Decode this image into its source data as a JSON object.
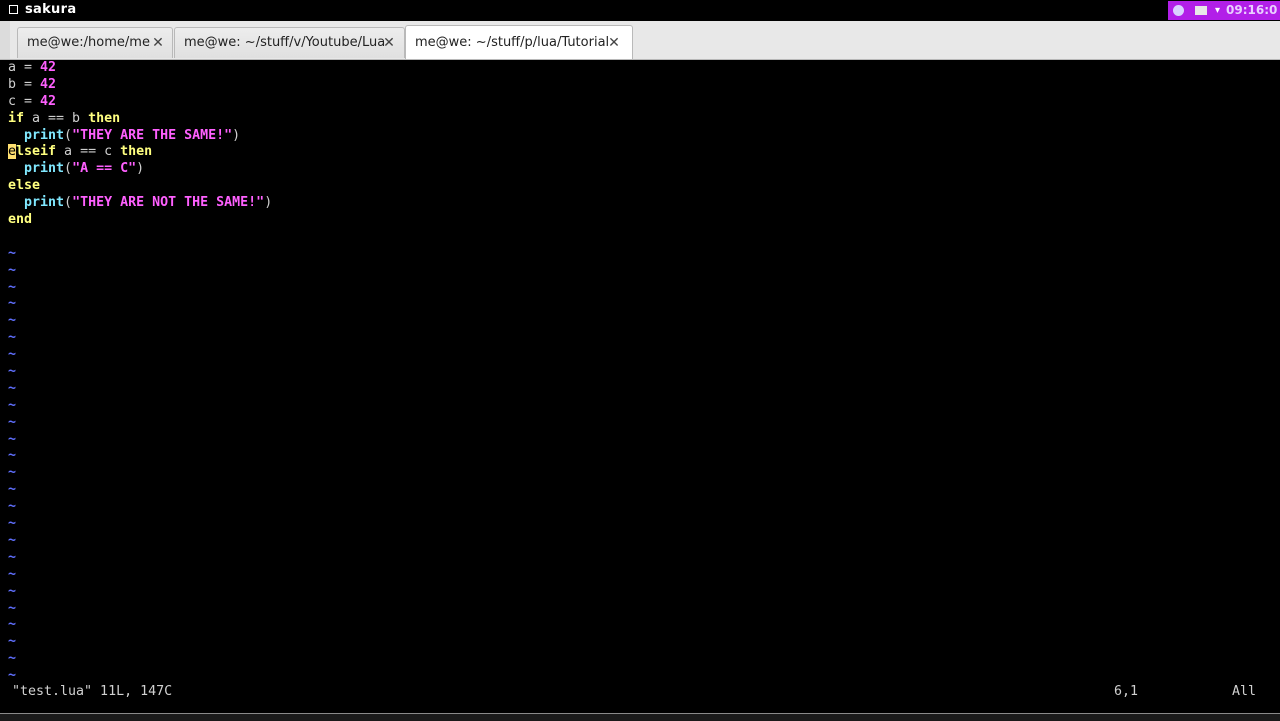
{
  "window": {
    "title": "sakura"
  },
  "tray": {
    "clock": "09:16:0"
  },
  "tabs": [
    {
      "label": "me@we:/home/me",
      "close": "✕"
    },
    {
      "label": "me@we: ~/stuff/v/Youtube/Lua",
      "close": "✕"
    },
    {
      "label": "me@we: ~/stuff/p/lua/Tutorial",
      "close": "✕"
    }
  ],
  "editor": {
    "lines": [
      [
        {
          "t": "a = ",
          "c": "plain"
        },
        {
          "t": "42",
          "c": "num"
        }
      ],
      [
        {
          "t": "b = ",
          "c": "plain"
        },
        {
          "t": "42",
          "c": "num"
        }
      ],
      [
        {
          "t": "c = ",
          "c": "plain"
        },
        {
          "t": "42",
          "c": "num"
        }
      ],
      [
        {
          "t": "if",
          "c": "kw"
        },
        {
          "t": " a == b ",
          "c": "plain"
        },
        {
          "t": "then",
          "c": "kw"
        }
      ],
      [
        {
          "t": "  ",
          "c": "plain"
        },
        {
          "t": "print",
          "c": "fn"
        },
        {
          "t": "(",
          "c": "plain"
        },
        {
          "t": "\"THEY ARE THE SAME!\"",
          "c": "str"
        },
        {
          "t": ")",
          "c": "plain"
        }
      ],
      [
        {
          "t": "e",
          "c": "cursor"
        },
        {
          "t": "lseif",
          "c": "kw"
        },
        {
          "t": " a == c ",
          "c": "plain"
        },
        {
          "t": "then",
          "c": "kw"
        }
      ],
      [
        {
          "t": "  ",
          "c": "plain"
        },
        {
          "t": "print",
          "c": "fn"
        },
        {
          "t": "(",
          "c": "plain"
        },
        {
          "t": "\"A == C\"",
          "c": "str"
        },
        {
          "t": ")",
          "c": "plain"
        }
      ],
      [
        {
          "t": "else",
          "c": "kw"
        }
      ],
      [
        {
          "t": "  ",
          "c": "plain"
        },
        {
          "t": "print",
          "c": "fn"
        },
        {
          "t": "(",
          "c": "plain"
        },
        {
          "t": "\"THEY ARE NOT THE SAME!\"",
          "c": "str"
        },
        {
          "t": ")",
          "c": "plain"
        }
      ],
      [
        {
          "t": "end",
          "c": "kw"
        }
      ],
      []
    ],
    "tilde_count": 26,
    "tilde_char": "~"
  },
  "statusline": {
    "message": "\"test.lua\" 11L, 147C",
    "position": "6,1",
    "scroll": "All"
  }
}
